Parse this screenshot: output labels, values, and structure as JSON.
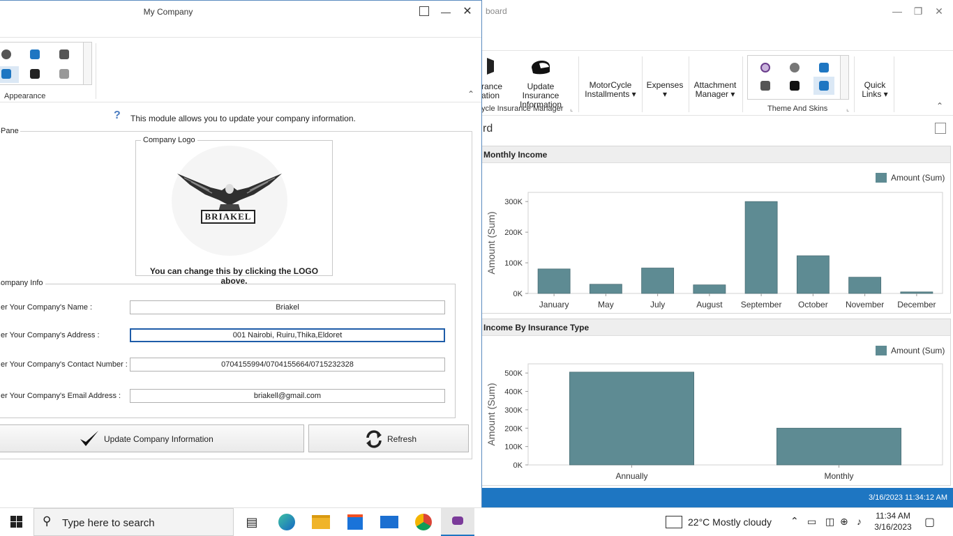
{
  "bg_window": {
    "title": "board",
    "ribbon": {
      "items": [
        {
          "label1": "rance",
          "label2": "ation"
        },
        {
          "label1": "Update Insurance",
          "label2": "Information"
        },
        {
          "label1": "MotorCycle",
          "label2": "Installments ▾"
        },
        {
          "label1": "Expenses",
          "label2": "▾"
        },
        {
          "label1": "Attachment",
          "label2": "Manager ▾"
        },
        {
          "label1": "Quick",
          "label2": "Links ▾"
        }
      ],
      "group_insurance": "ycle Insurance Manager",
      "group_theme": "Theme And Skins"
    },
    "page_title": "rd",
    "monthly_panel_title": "Monthly Income",
    "type_panel_title": "Income By Insurance Type",
    "status_time": "3/16/2023 11:34:12 AM"
  },
  "fg_window": {
    "title": "My Company",
    "appearance_label": "Appearance",
    "info_text": "This module allows you to update your company information.",
    "pane_label": "Pane",
    "logo_group": "Company Logo",
    "logo_text": "BRIAKEL",
    "logo_hint": "You can change this by clicking the LOGO above.",
    "info_group": "ompany Info",
    "fields": [
      {
        "label": "er Your Company's Name :",
        "value": "Briakel"
      },
      {
        "label": "er Your Company's Address :",
        "value": "001 Nairobi, Ruiru,Thika,Eldoret"
      },
      {
        "label": "er Your Company's Contact Number :",
        "value": "0704155994/0704155664/0715232328"
      },
      {
        "label": "er Your Company's Email Address :",
        "value": "briakell@gmail.com"
      }
    ],
    "update_button": "Update Company Information",
    "refresh_button": "Refresh"
  },
  "taskbar": {
    "search_placeholder": "Type here to search",
    "weather": "22°C  Mostly cloudy",
    "time": "11:34 AM",
    "date": "3/16/2023"
  },
  "chart_data": [
    {
      "type": "bar",
      "title": "Monthly Income",
      "categories": [
        "January",
        "May",
        "July",
        "August",
        "September",
        "October",
        "November",
        "December"
      ],
      "series": [
        {
          "name": "Amount (Sum)",
          "values": [
            80000,
            30000,
            83000,
            28000,
            300000,
            123000,
            53000,
            5000
          ]
        }
      ],
      "ylabel": "Amount (Sum)",
      "yticks": [
        "0K",
        "100K",
        "200K",
        "300K"
      ],
      "ylim": [
        0,
        330000
      ],
      "color": "#5e8b93",
      "legend": "top-right"
    },
    {
      "type": "bar",
      "title": "Income By Insurance Type",
      "categories": [
        "Annually",
        "Monthly"
      ],
      "series": [
        {
          "name": "Amount (Sum)",
          "values": [
            505000,
            200000
          ]
        }
      ],
      "ylabel": "Amount (Sum)",
      "yticks": [
        "0K",
        "100K",
        "200K",
        "300K",
        "400K",
        "500K"
      ],
      "ylim": [
        0,
        550000
      ],
      "color": "#5e8b93",
      "legend": "top-right"
    }
  ]
}
